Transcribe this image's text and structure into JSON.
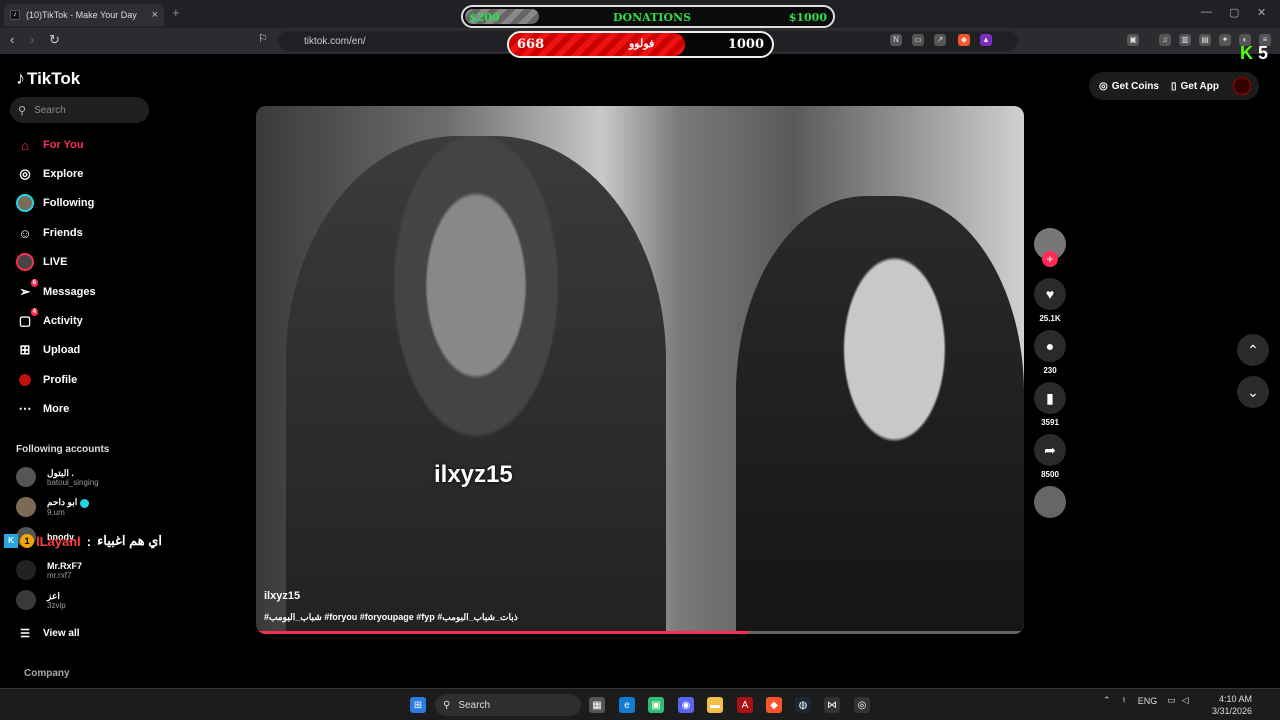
{
  "browser": {
    "tab_title": "(10)TikTok - Make Your Day",
    "tab_favicon": "tiktok-icon",
    "url": "tiktok.com/en/"
  },
  "overlay": {
    "donations": {
      "left": "$200",
      "title": "DONATIONS",
      "right": "$1000",
      "progress": 0.2
    },
    "follow_goal": {
      "current": "668",
      "label": "فولوو",
      "goal": "1000",
      "progress": 0.668
    },
    "kick_count": "5",
    "chat": {
      "badge": "1",
      "user": "lLayanl",
      "separator": ":",
      "message": "اي هم اغبياء"
    }
  },
  "tiktok": {
    "logo": "TikTok",
    "search_placeholder": "Search",
    "nav": [
      {
        "label": "For You",
        "icon": "home-icon",
        "active": true
      },
      {
        "label": "Explore",
        "icon": "compass-icon"
      },
      {
        "label": "Following",
        "icon": "following-avatar-icon"
      },
      {
        "label": "Friends",
        "icon": "friends-icon"
      },
      {
        "label": "LIVE",
        "icon": "live-icon"
      },
      {
        "label": "Messages",
        "icon": "messages-icon",
        "badge": "6"
      },
      {
        "label": "Activity",
        "icon": "activity-icon",
        "badge": "4"
      },
      {
        "label": "Upload",
        "icon": "upload-icon"
      },
      {
        "label": "Profile",
        "icon": "profile-icon"
      },
      {
        "label": "More",
        "icon": "more-icon"
      }
    ],
    "following_title": "Following accounts",
    "accounts": [
      {
        "name": "البتول .",
        "handle": "batoul_singing"
      },
      {
        "name": "ابو داحم",
        "handle": "9.um",
        "verified": true
      },
      {
        "name": "bnody",
        "handle": ""
      },
      {
        "name": "Mr.RxF7",
        "handle": "mr.rxf7"
      },
      {
        "name": "اعز",
        "handle": "3zvip"
      }
    ],
    "view_all": "View all",
    "company": "Company",
    "get_coins": "Get Coins",
    "get_app": "Get App"
  },
  "video": {
    "watermark": "ilxyz15",
    "author": "ilxyz15",
    "caption": "#شباب_البومب #foryou #foryoupage #fyp #ذبات_شباب_البومب",
    "progress": 0.64,
    "likes": "25.1K",
    "comments": "230",
    "saves": "3591",
    "shares": "8500"
  },
  "taskbar": {
    "search": "Search",
    "lang": "ENG",
    "time": "4:10 AM",
    "date": "3/31/2026"
  }
}
